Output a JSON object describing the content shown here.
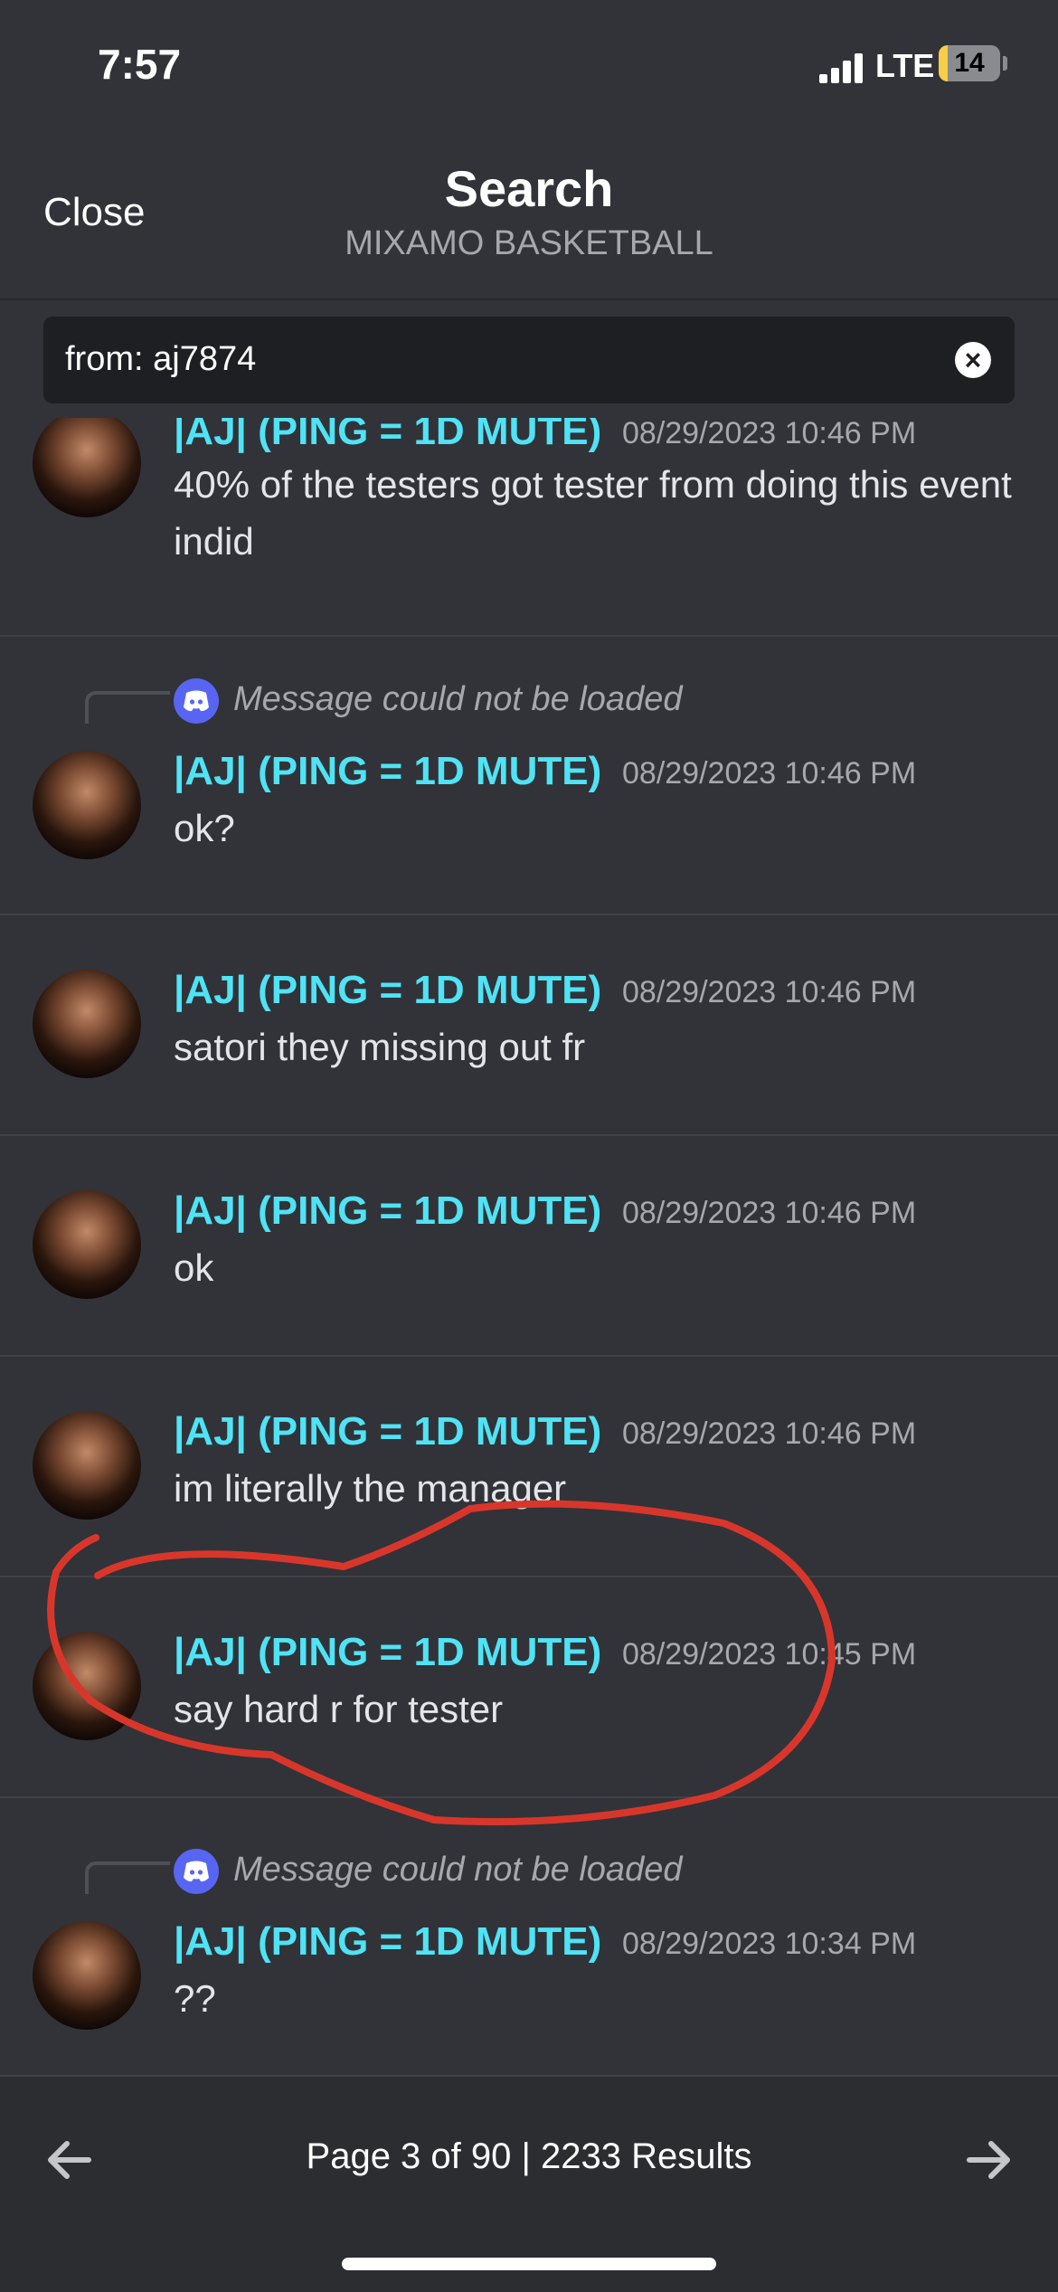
{
  "status_bar": {
    "time": "7:57",
    "network": "LTE",
    "battery": "14",
    "battery_level": 0.14
  },
  "header": {
    "close_label": "Close",
    "title": "Search",
    "subtitle": "MIXAMO BASKETBALL"
  },
  "search": {
    "query": "from: aj7874"
  },
  "colors": {
    "background": "#313338",
    "author": "#4fe3f5",
    "footer": "#2b2d31",
    "discord_blurple": "#5865f2",
    "annotation": "#d9362b"
  },
  "messages": [
    {
      "author": "|AJ| (PING = 1D MUTE)",
      "timestamp": "08/29/2023 10:46 PM",
      "content": "40% of the testers got tester from doing this event indid"
    },
    {
      "reply": "Message could not be loaded",
      "author": "|AJ| (PING = 1D MUTE)",
      "timestamp": "08/29/2023 10:46 PM",
      "content": "ok?"
    },
    {
      "author": "|AJ| (PING = 1D MUTE)",
      "timestamp": "08/29/2023 10:46 PM",
      "content": "satori they missing out fr"
    },
    {
      "author": "|AJ| (PING = 1D MUTE)",
      "timestamp": "08/29/2023 10:46 PM",
      "content": "ok"
    },
    {
      "author": "|AJ| (PING = 1D MUTE)",
      "timestamp": "08/29/2023 10:46 PM",
      "content": "im literally the manager"
    },
    {
      "author": "|AJ| (PING = 1D MUTE)",
      "timestamp": "08/29/2023 10:45 PM",
      "content": "say hard r for tester"
    },
    {
      "reply": "Message could not be loaded",
      "author": "|AJ| (PING = 1D MUTE)",
      "timestamp": "08/29/2023 10:34 PM",
      "content": "??"
    }
  ],
  "footer": {
    "pagination": "Page 3 of 90  |  2233 Results",
    "prev_icon": "arrow-left-icon",
    "next_icon": "arrow-right-icon"
  }
}
